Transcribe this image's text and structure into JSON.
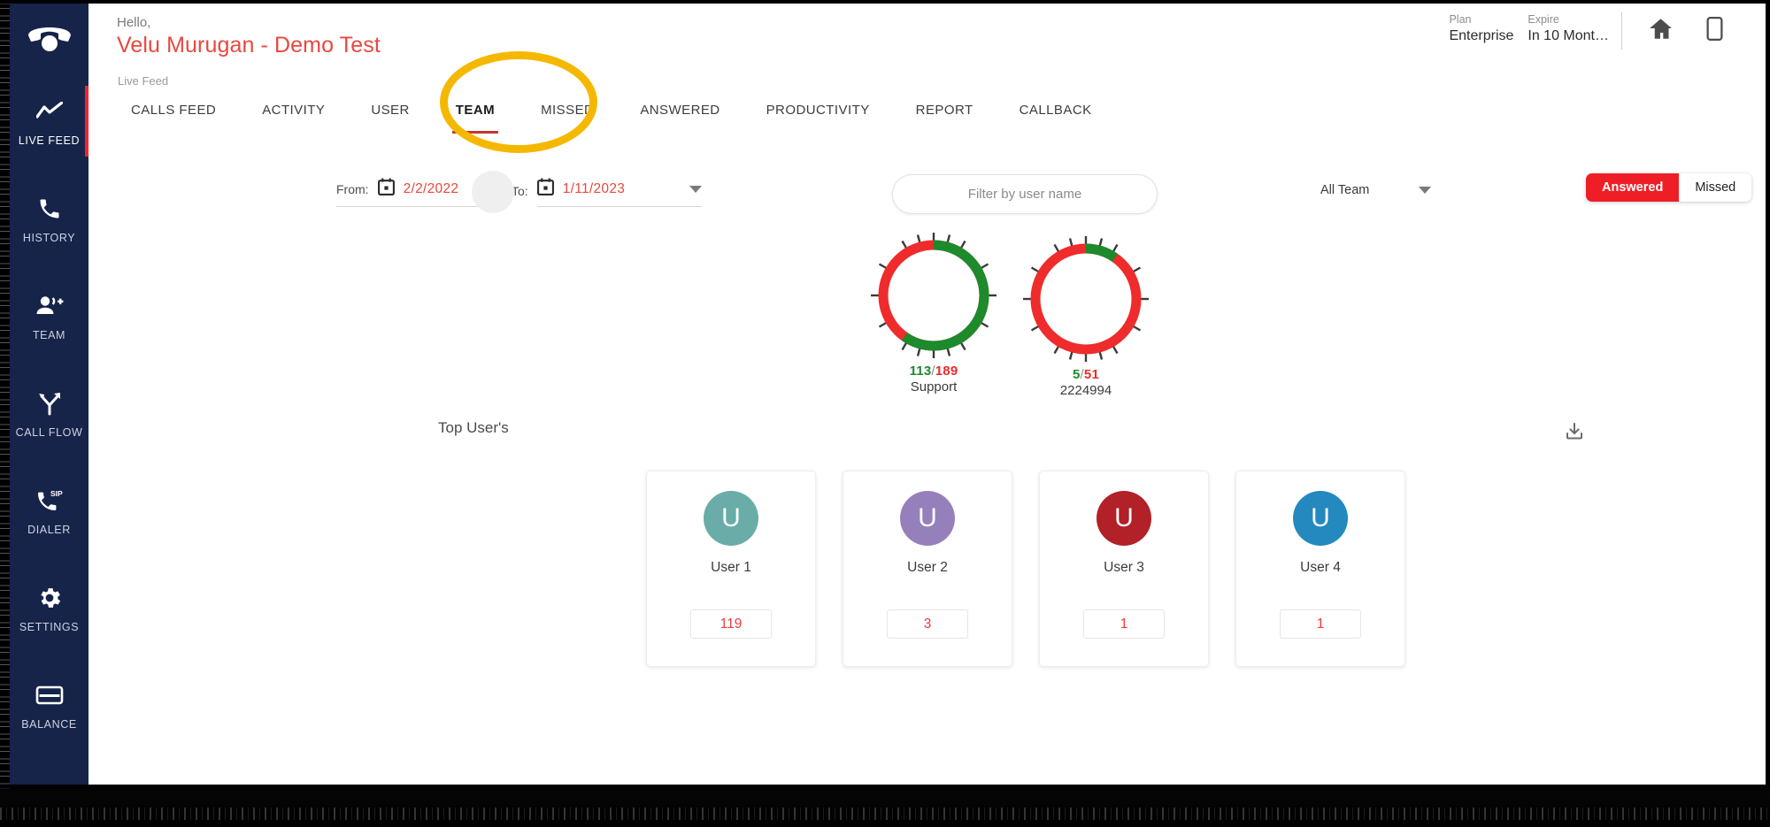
{
  "header": {
    "hello": "Hello,",
    "username": "Velu Murugan - Demo Test",
    "breadcrumb": "Live Feed",
    "plan_label": "Plan",
    "plan_value": "Enterprise",
    "expire_label": "Expire",
    "expire_value": "In 10 Mont…",
    "home_icon": "home-icon",
    "mobile_icon": "mobile-icon"
  },
  "sidebar": {
    "logo_icon": "phone-hangup-logo-icon",
    "items": [
      {
        "label": "LIVE FEED",
        "icon": "line-chart-icon",
        "active": true
      },
      {
        "label": "HISTORY",
        "icon": "phone-icon",
        "active": false
      },
      {
        "label": "TEAM",
        "icon": "add-people-icon",
        "active": false
      },
      {
        "label": "CALL FLOW",
        "icon": "call-flow-arrows-icon",
        "active": false
      },
      {
        "label": "DIALER",
        "icon": "sip-phone-icon",
        "active": false
      },
      {
        "label": "SETTINGS",
        "icon": "gear-icon",
        "active": false
      },
      {
        "label": "BALANCE",
        "icon": "credit-card-icon",
        "active": false
      }
    ]
  },
  "tabs": [
    {
      "label": "CALLS FEED",
      "active": false
    },
    {
      "label": "ACTIVITY",
      "active": false
    },
    {
      "label": "USER",
      "active": false
    },
    {
      "label": "TEAM",
      "active": true
    },
    {
      "label": "MISSED",
      "active": false
    },
    {
      "label": "ANSWERED",
      "active": false
    },
    {
      "label": "PRODUCTIVITY",
      "active": false
    },
    {
      "label": "REPORT",
      "active": false
    },
    {
      "label": "CALLBACK",
      "active": false
    }
  ],
  "annotation": {
    "shape": "yellow-ellipse-highlight",
    "target": "TEAM",
    "color": "#f5b800"
  },
  "filters": {
    "from_label": "From:",
    "from_value": "2/2/2022",
    "to_label": "To:",
    "to_value": "1/11/2023",
    "calendar_icon": "calendar-icon",
    "caret_icon": "chevron-down-icon",
    "user_filter_placeholder": "Filter by user name",
    "user_filter_value": "",
    "team_select_value": "All Team",
    "toggle": {
      "answered": "Answered",
      "missed": "Missed",
      "selected": "Answered"
    }
  },
  "colors": {
    "accent_red": "#ef1d26",
    "brand_red": "#e8483f",
    "sidebar_navy": "#16244a",
    "green": "#1d8a2c",
    "annotation_yellow": "#f5b800"
  },
  "chart_data": [
    {
      "type": "pie",
      "title": "Support",
      "label": "113/189",
      "answered": 113,
      "total": 189,
      "missed": 76,
      "answered_pct": 59.8,
      "series": [
        {
          "name": "Answered",
          "value": 113,
          "color": "#1d8a2c"
        },
        {
          "name": "Missed",
          "value": 76,
          "color": "#ef2b2b"
        }
      ],
      "legend": "none",
      "grid": false
    },
    {
      "type": "pie",
      "title": "2224994",
      "label": "5/51",
      "answered": 5,
      "total": 51,
      "missed": 46,
      "answered_pct": 9.8,
      "series": [
        {
          "name": "Answered",
          "value": 5,
          "color": "#1d8a2c"
        },
        {
          "name": "Missed",
          "value": 46,
          "color": "#ef2b2b"
        }
      ],
      "legend": "none",
      "grid": false
    },
    {
      "type": "bar",
      "title": "Top User's",
      "categories": [
        "User 1",
        "User 2",
        "User 3",
        "User 4"
      ],
      "values": [
        119,
        3,
        1,
        1
      ],
      "xlabel": "",
      "ylabel": "",
      "grid": false,
      "legend": "none"
    }
  ],
  "top_users": {
    "title": "Top User's",
    "download_icon": "download-icon",
    "cards": [
      {
        "initial": "U",
        "name": "User 1",
        "count": "119",
        "color": "#6aada8"
      },
      {
        "initial": "U",
        "name": "User 2",
        "count": "3",
        "color": "#9680bb"
      },
      {
        "initial": "U",
        "name": "User 3",
        "count": "1",
        "color": "#b22028"
      },
      {
        "initial": "U",
        "name": "User 4",
        "count": "1",
        "color": "#2489bf"
      }
    ]
  }
}
